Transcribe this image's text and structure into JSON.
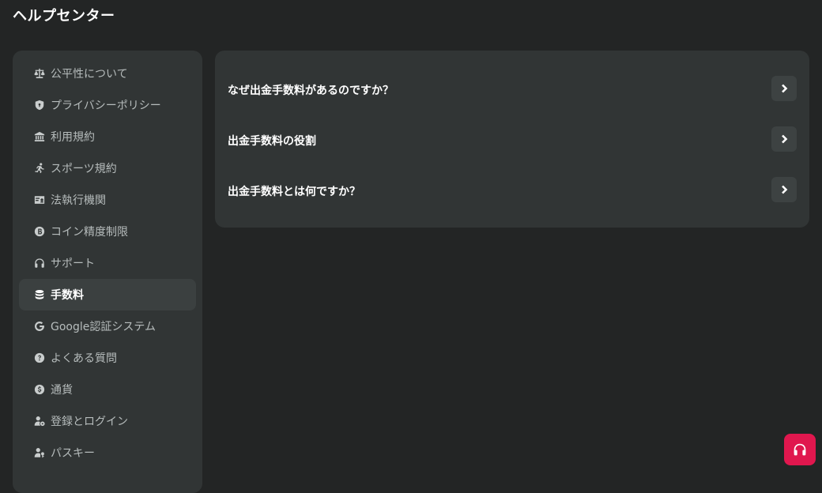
{
  "page": {
    "title": "ヘルプセンター"
  },
  "sidebar": {
    "items": [
      {
        "label": "公平性について",
        "icon": "scale-icon",
        "active": false
      },
      {
        "label": "プライバシーポリシー",
        "icon": "shield-icon",
        "active": false
      },
      {
        "label": "利用規約",
        "icon": "bank-icon",
        "active": false
      },
      {
        "label": "スポーツ規約",
        "icon": "running-icon",
        "active": false
      },
      {
        "label": "法執行機関",
        "icon": "id-card-icon",
        "active": false
      },
      {
        "label": "コイン精度制限",
        "icon": "coin-icon",
        "active": false
      },
      {
        "label": "サポート",
        "icon": "headphones-icon",
        "active": false
      },
      {
        "label": "手数料",
        "icon": "database-icon",
        "active": true
      },
      {
        "label": "Google認証システム",
        "icon": "google-icon",
        "active": false
      },
      {
        "label": "よくある質問",
        "icon": "question-icon",
        "active": false
      },
      {
        "label": "通貨",
        "icon": "currency-icon",
        "active": false
      },
      {
        "label": "登録とログイン",
        "icon": "user-settings-icon",
        "active": false
      },
      {
        "label": "パスキー",
        "icon": "user-key-icon",
        "active": false
      }
    ]
  },
  "faq": {
    "items": [
      {
        "question": "なぜ出金手数料があるのですか？"
      },
      {
        "question": "出金手数料の役割"
      },
      {
        "question": "出金手数料とは何ですか？"
      }
    ]
  },
  "support_button": {
    "icon": "headphones-icon",
    "color": "#e0174e"
  }
}
